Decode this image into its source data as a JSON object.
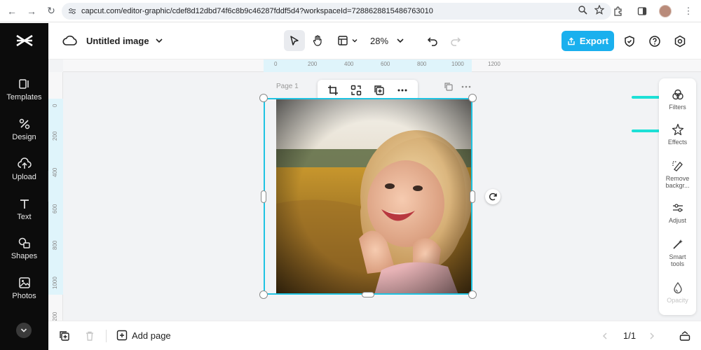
{
  "browser": {
    "url": "capcut.com/editor-graphic/cdef8d12dbd74f6c8b9c46287fddf5d4?workspaceId=7288628815486763010"
  },
  "sidebar": {
    "items": [
      {
        "label": "Templates",
        "icon": "templates-icon"
      },
      {
        "label": "Design",
        "icon": "design-icon"
      },
      {
        "label": "Upload",
        "icon": "upload-icon"
      },
      {
        "label": "Text",
        "icon": "text-icon"
      },
      {
        "label": "Shapes",
        "icon": "shapes-icon"
      },
      {
        "label": "Photos",
        "icon": "photos-icon"
      }
    ]
  },
  "header": {
    "title": "Untitled image",
    "zoom": "28%",
    "export_label": "Export"
  },
  "canvas": {
    "page_label": "Page 1",
    "ruler_top": [
      "0",
      "200",
      "400",
      "600",
      "800",
      "1000",
      "1200"
    ],
    "ruler_left": [
      "0",
      "200",
      "400",
      "600",
      "800",
      "1000",
      "200"
    ]
  },
  "right_panel": {
    "items": [
      {
        "label": "Filters",
        "icon": "filters-icon"
      },
      {
        "label": "Effects",
        "icon": "effects-icon"
      },
      {
        "label": "Remove backgr...",
        "icon": "remove-background-icon"
      },
      {
        "label": "Adjust",
        "icon": "adjust-icon"
      },
      {
        "label": "Smart tools",
        "icon": "smart-tools-icon"
      },
      {
        "label": "Opacity",
        "icon": "opacity-icon"
      }
    ]
  },
  "bottom": {
    "add_page_label": "Add page",
    "pager": "1/1"
  },
  "colors": {
    "accent": "#1ab0ee",
    "selection": "#1fc3e2",
    "annotation_arrow": "#1de0d6",
    "sidebar_bg": "#0c0c0c"
  }
}
